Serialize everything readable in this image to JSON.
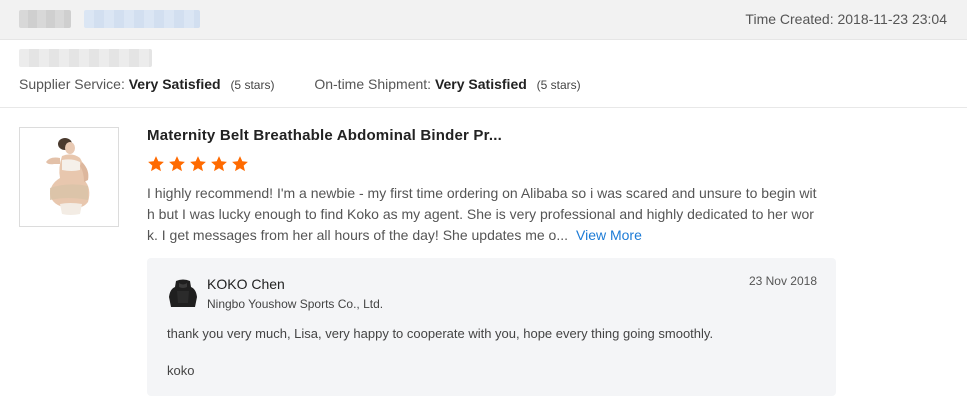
{
  "header": {
    "time_created": "Time Created: 2018-11-23 23:04"
  },
  "ratings": [
    {
      "label": "Supplier Service:",
      "value": "Very Satisfied",
      "note": "(5 stars)"
    },
    {
      "label": "On-time Shipment:",
      "value": "Very Satisfied",
      "note": "(5 stars)"
    }
  ],
  "review": {
    "product_title": "Maternity Belt Breathable Abdominal Binder Pr...",
    "star_count": 5,
    "star_color": "#ff6a00",
    "text_lines": [
      "I highly recommend! I'm a newbie - my first time ordering on Alibaba so i was scared and unsure to begin wit",
      "h but I was lucky enough to find Koko as my agent. She is very professional and highly dedicated to her wor",
      "k. I get messages from her all hours of the day! She updates me o..."
    ],
    "view_more": "View More",
    "link_color": "#1c7bd6"
  },
  "reply": {
    "name": "KOKO Chen",
    "company": "Ningbo Youshow Sports Co., Ltd.",
    "date": "23 Nov 2018",
    "message": "thank you very much, Lisa, very happy to cooperate with you, hope every thing going smoothly.",
    "signature": "koko"
  }
}
